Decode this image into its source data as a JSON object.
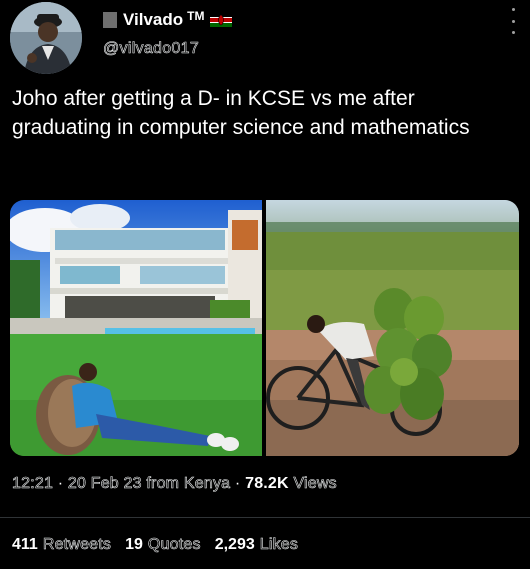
{
  "author": {
    "name": "Vilvado",
    "trademark": "TM",
    "handle": "@vilvado017"
  },
  "tweet": {
    "text": "Joho after getting a D- in KCSE vs me after graduating in computer science and mathematics"
  },
  "meta": {
    "time": "12:21",
    "date": "20 Feb 23",
    "from_label": "from",
    "location": "Kenya",
    "views_count": "78.2K",
    "views_label": "Views",
    "separator": "·"
  },
  "stats": {
    "retweets_count": "411",
    "retweets_label": "Retweets",
    "quotes_count": "19",
    "quotes_label": "Quotes",
    "likes_count": "2,293",
    "likes_label": "Likes"
  },
  "colors": {
    "background": "#000000",
    "text": "#e7e9ea",
    "divider": "#2f3336"
  },
  "icons": {
    "more": "more-vertical-icon",
    "flag": "kenya-flag-icon"
  }
}
